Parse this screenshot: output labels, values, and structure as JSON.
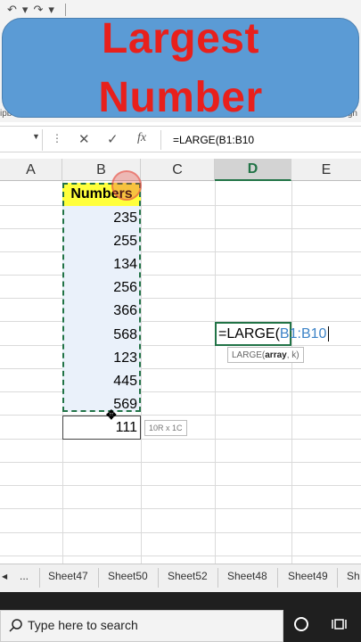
{
  "banner": {
    "line1": "Largest",
    "line2": "Number"
  },
  "ribbon": {
    "left_label": "ipboard",
    "right_label": "Align",
    "qat_undo": "↶",
    "qat_redo": "↷"
  },
  "formula_bar": {
    "cancel_icon": "✕",
    "enter_icon": "✓",
    "fx_label": "fx",
    "formula": "=LARGE(B1:B10"
  },
  "columns": [
    "A",
    "B",
    "C",
    "D",
    "E"
  ],
  "active_column": "D",
  "sheet": {
    "header": "Numbers",
    "values": [
      "235",
      "255",
      "134",
      "256",
      "366",
      "568",
      "123",
      "445",
      "569"
    ],
    "last_value": "111",
    "selection_tip": "10R x 1C"
  },
  "edit_cell": {
    "prefix": "=LARGE(",
    "ref": "B1:B10",
    "tooltip_name": "LARGE(",
    "tooltip_arg": "array",
    "tooltip_rest": ", k)"
  },
  "tabs": {
    "nav_left": "◀",
    "more": "...",
    "items": [
      "Sheet47",
      "Sheet50",
      "Sheet52",
      "Sheet48",
      "Sheet49",
      "Sh"
    ]
  },
  "taskbar": {
    "search_placeholder": "Type here to search",
    "search_icon": "search-icon",
    "cortana_icon": "cortana-icon",
    "task_view_icon": "task-view-icon"
  }
}
